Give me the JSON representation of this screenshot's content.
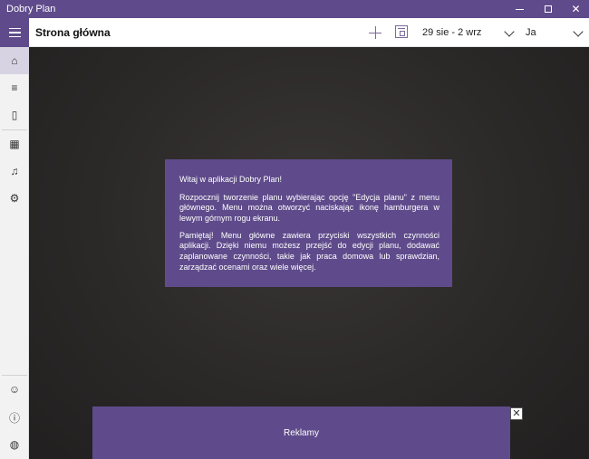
{
  "window": {
    "title": "Dobry Plan",
    "minimize_icon": "minimize-icon",
    "maximize_icon": "maximize-icon",
    "close_glyph": "✕"
  },
  "header": {
    "title": "Strona główna",
    "date_range": "29 sie - 2 wrz",
    "user": "Ja"
  },
  "sidebar": {
    "top_items": [
      {
        "icon": "home-icon",
        "glyph": "⌂"
      },
      {
        "icon": "plan-edit-icon",
        "glyph": "≡"
      },
      {
        "icon": "book-icon",
        "glyph": "▯"
      },
      {
        "icon": "calendar-icon",
        "glyph": "▦"
      },
      {
        "icon": "music-icon",
        "glyph": "♫"
      },
      {
        "icon": "settings-icon",
        "glyph": "⚙"
      }
    ],
    "bottom_items": [
      {
        "icon": "smiley-icon",
        "glyph": "☺"
      },
      {
        "icon": "info-icon",
        "glyph": "ⓘ"
      },
      {
        "icon": "globe-icon",
        "glyph": "◍"
      }
    ]
  },
  "welcome": {
    "greeting": "Witaj w aplikacji Dobry Plan!",
    "paragraph1": "Rozpocznij tworzenie planu wybierając opcję \"Edycja planu\" z menu głównego. Menu można otworzyć naciskając ikonę hamburgera w lewym górnym rogu ekranu.",
    "paragraph2": "Pamiętaj! Menu główne zawiera przyciski wszystkich czynności aplikacji. Dzięki niemu możesz przejść do edycji planu, dodawać zaplanowane czynności, takie jak praca domowa lub sprawdzian, zarządzać ocenami oraz wiele więcej."
  },
  "ads": {
    "label": "Reklamy",
    "close_glyph": "✕"
  },
  "colors": {
    "accent": "#5f4b8b",
    "chalkboard": "#2b2828",
    "sidebar": "#f2f2f2"
  }
}
